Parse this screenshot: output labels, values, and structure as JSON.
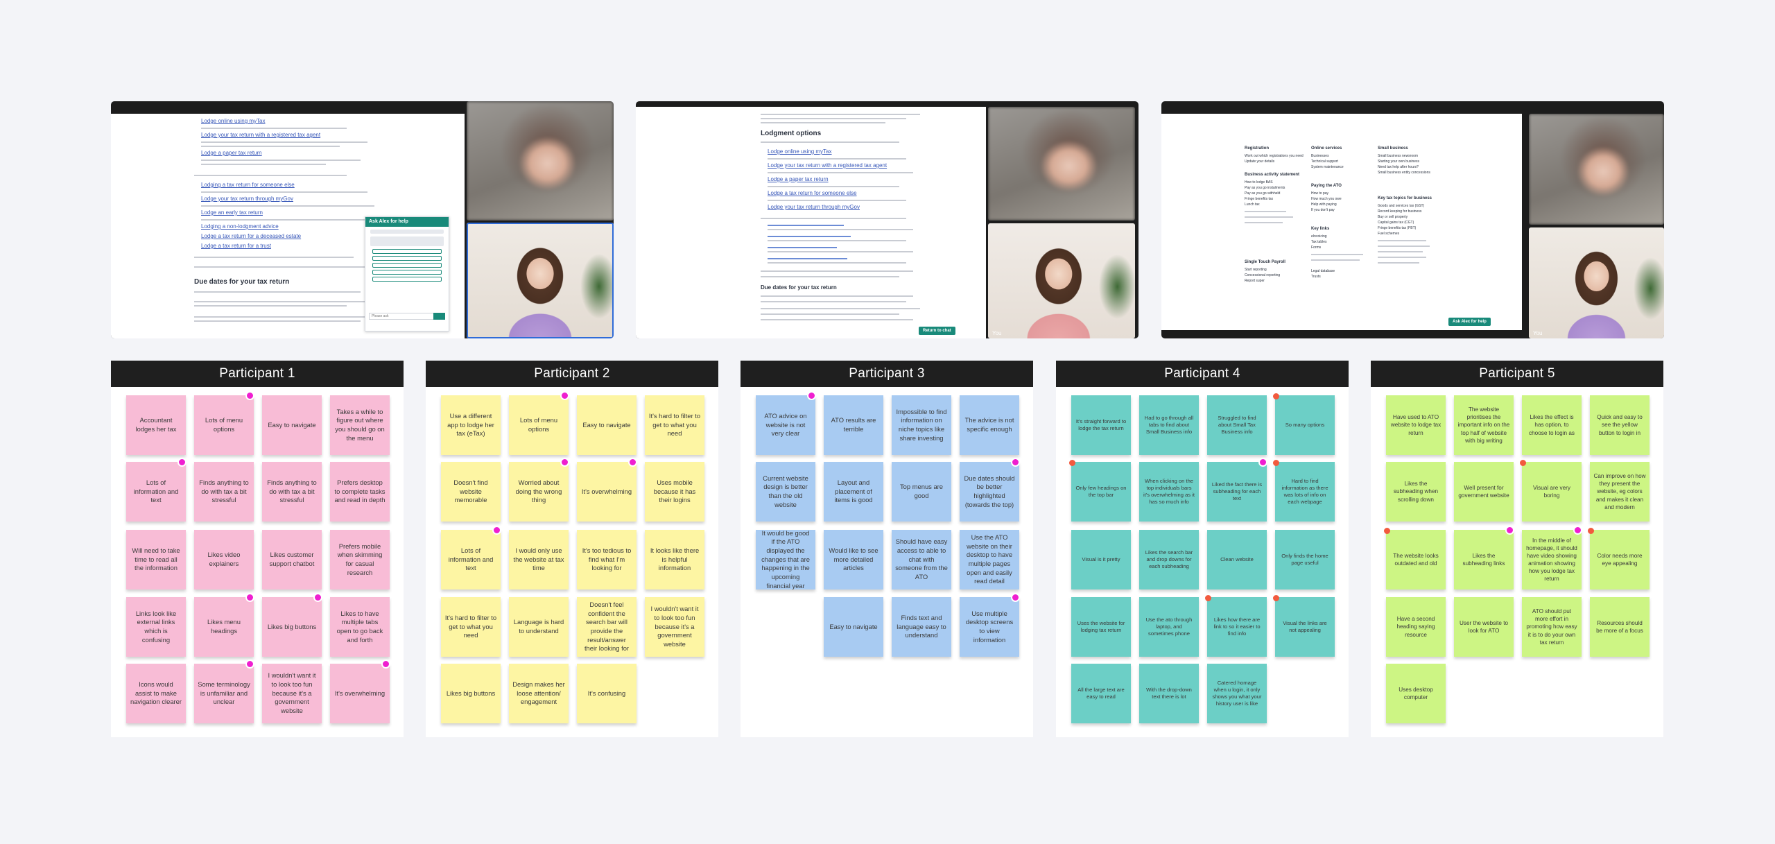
{
  "screens": [
    {
      "doc": {
        "title": "Due dates for your tax return",
        "lines": [
          "Lodge online using myTax",
          "Lodge your tax return with a registered tax agent",
          "Lodge a paper tax return",
          "Lodging a tax return for someone else",
          "Lodge your tax return through myGov",
          "Lodge an early tax return",
          "Lodging a non-lodgment advice",
          "Lodge a tax return for a deceased estate",
          "Lodge a tax return for a trust"
        ]
      },
      "chat": {
        "title": "Ask Alex for help",
        "placeholder": "Please ask"
      }
    },
    {
      "doc": {
        "title": "Lodgment options",
        "subtitle": "Due dates for your tax return",
        "lines": [
          "Lodge online using myTax",
          "Lodge your tax return with a registered tax agent",
          "Lodge a paper tax return",
          "Lodge a tax return for someone else",
          "Lodge your tax return through myGov"
        ]
      },
      "ask_label": "Return to chat",
      "you_label": "You"
    },
    {
      "columns": [
        {
          "heading": "Registration",
          "items": [
            "Work out which registrations you need",
            "Update your details"
          ],
          "heading2": "Business activity statement",
          "items2": [
            "How to lodge BAS",
            "Pay as you go instalments",
            "Pay as you go withheld",
            "Fringe benefits tax",
            "Lunch tax"
          ],
          "heading3": "Single Touch Payroll",
          "items3": [
            "Start reporting",
            "Concessional reporting",
            "Report super"
          ]
        },
        {
          "heading": "Online services",
          "items": [
            "Businesses",
            "Technical support",
            "System maintenance"
          ],
          "heading2": "Paying the ATO",
          "items2": [
            "How to pay",
            "How much you owe",
            "Help with paying",
            "If you don't pay"
          ],
          "heading3": "Key links",
          "items3": [
            "eInvoicing",
            "Tax tables",
            "Forms",
            "Legal database",
            "Trusts"
          ]
        },
        {
          "heading": "Small business",
          "items": [
            "Small business newsroom",
            "Starting your own business",
            "Need tax help after hours?",
            "Small business entity concessions"
          ],
          "heading2": "Key tax topics for business",
          "items2": [
            "Goods and services tax (GST)",
            "Record keeping for business",
            "Buy or sell property",
            "Capital gains tax (CGT)",
            "Fringe benefits tax (FBT)",
            "Fuel schemes"
          ]
        }
      ],
      "ask_label": "Ask Alex for help",
      "you_label": "You"
    }
  ],
  "participants": [
    {
      "name": "Participant 1",
      "color": "#f8bcd6",
      "notes": [
        "Accountant lodges her tax",
        "Lots of menu options",
        "Easy to navigate",
        "Takes a while to figure out where you should go on the menu",
        "Lots of information and text",
        "Finds anything to do with tax a bit stressful",
        "Finds anything to do with tax a bit stressful",
        "Prefers desktop to complete tasks and read in depth",
        "Will need to take time to read all the information",
        "Likes video explainers",
        "Likes customer support chatbot",
        "Prefers mobile when skimming for casual research",
        "Links look like external links which is confusing",
        "Likes menu headings",
        "Likes big buttons",
        "Likes to have multiple tabs open to go back and forth",
        "Icons would assist to make navigation clearer",
        "Some terminology is unfamiliar and unclear",
        "I wouldn't want it to look too fun because it's a government website",
        "It's overwhelming"
      ]
    },
    {
      "name": "Participant 2",
      "color": "#fdf5a3",
      "notes": [
        "Use a different app to lodge her tax (eTax)",
        "Lots of menu options",
        "Easy to navigate",
        "It's hard to filter to get to what you need",
        "Doesn't find website memorable",
        "Worried about doing the wrong thing",
        "It's overwhelming",
        "Uses mobile because it has their logins",
        "Lots of information and text",
        "I would only use the website at tax time",
        "It's too tedious to find what I'm looking for",
        "It looks like there is helpful information",
        "It's hard to filter to get to what you need",
        "Language is hard to understand",
        "Doesn't feel confident the search bar will provide the result/answer their looking for",
        "I wouldn't want it to look too fun because it's a government website",
        "Likes big buttons",
        "Design makes her loose attention/ engagement",
        "It's confusing"
      ]
    },
    {
      "name": "Participant 3",
      "color": "#a8cbf2",
      "notes": [
        "ATO advice on website is not very clear",
        "ATO  results are terrible",
        "Impossible to find information on niche topics like share investing",
        "The advice is not specific enough",
        "Current website design is better than the old website",
        "Layout and placement of items is good",
        "Top menus are good",
        "Due dates should be better highlighted (towards the top)",
        "It would be good if the ATO displayed the changes  that are happening in the upcoming financial year",
        "Would like to see more detailed articles",
        "Should have easy access to able to chat with someone from the ATO",
        "Use the ATO website on their desktop to have multiple pages open and easily read detail",
        "Easy to navigate",
        "Finds text and language easy to understand",
        "Use multiple desktop screens to view information"
      ]
    },
    {
      "name": "Participant 4",
      "color": "#6ccfc6",
      "notes": [
        "It's straight forward to lodge the tax return",
        "Had to go through all tabs to find about Small Business info",
        "Struggled to find about Small Tax Business info",
        "So many options",
        "Only few headings on the top bar",
        "When clicking on the top individuals bars it's overwhelming as it has so much info",
        "Liked the fact there is subheading for each text",
        "Hard to find information as there was lots of info on each webpage",
        "Visual is it pretty",
        "Likes the search bar and drop downs for each subheading",
        "Clean website",
        "Only finds the home page useful",
        "Uses the website for lodging tax return",
        "Use the ato through laptop, and sometimes phone",
        "Likes how there are link to so it easier to find info",
        "Visual the links are not appealing",
        "All the large text are easy to read",
        "With the drop-down text there is lot",
        "Catered homage when u login, it only shows you what your history user is like"
      ]
    },
    {
      "name": "Participant 5",
      "color": "#cdf584",
      "notes": [
        "Have used to ATO website to lodge tax return",
        "The website prioritises the important info on the top half of website with big writing",
        "Likes the effect is has option, to choose to login as",
        "Quick and easy to see the yellow button to login in",
        "Likes the subheading when scrolling down",
        "Well present for government website",
        "Visual are very boring",
        "Can improve on how they present the website, eg colors and makes it clean and modern",
        "The website looks outdated and old",
        "Likes the subheading links",
        "In the middle of homepage, it should have video showing animation showing how you lodge tax return",
        "Color needs more eye appealing",
        "Have a second heading saying resource",
        "User the website to look for ATO",
        "ATO should put more effort in promoting how easy it is to do your own tax return",
        "Resources should be more of a focus",
        "Uses desktop computer"
      ]
    }
  ]
}
